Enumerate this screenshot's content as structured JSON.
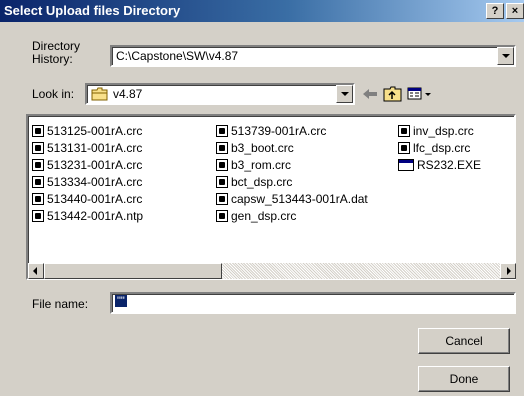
{
  "window": {
    "title": "Select Upload files Directory",
    "help_button": "?",
    "close_button": "×"
  },
  "directory_history": {
    "label_line1": "Directory",
    "label_line2": "History:",
    "value": "C:\\Capstone\\SW\\v4.87"
  },
  "look_in": {
    "label": "Look in:",
    "value": "v4.87"
  },
  "files": {
    "col1": [
      "513125-001rA.crc",
      "513131-001rA.crc",
      "513231-001rA.crc",
      "513334-001rA.crc",
      "513440-001rA.crc",
      "513442-001rA.ntp"
    ],
    "col2": [
      "513739-001rA.crc",
      "b3_boot.crc",
      "b3_rom.crc",
      "bct_dsp.crc",
      "capsw_513443-001rA.dat",
      "gen_dsp.crc"
    ],
    "col3": [
      "inv_dsp.crc",
      "lfc_dsp.crc",
      "RS232.EXE"
    ]
  },
  "file_name": {
    "label": "File name:",
    "value": "\"\""
  },
  "buttons": {
    "cancel": "Cancel",
    "done": "Done"
  }
}
